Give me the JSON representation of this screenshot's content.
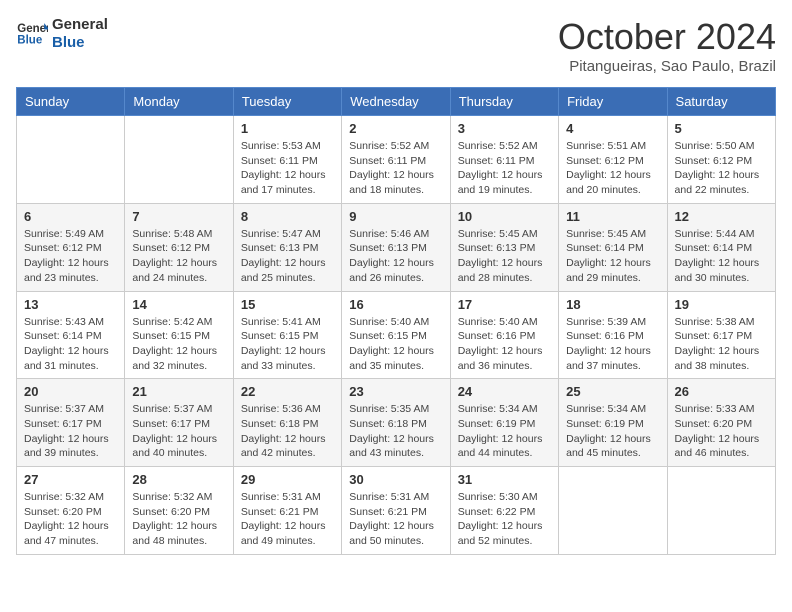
{
  "header": {
    "logo_line1": "General",
    "logo_line2": "Blue",
    "month_title": "October 2024",
    "location": "Pitangueiras, Sao Paulo, Brazil"
  },
  "days_of_week": [
    "Sunday",
    "Monday",
    "Tuesday",
    "Wednesday",
    "Thursday",
    "Friday",
    "Saturday"
  ],
  "weeks": [
    [
      {
        "day": "",
        "info": ""
      },
      {
        "day": "",
        "info": ""
      },
      {
        "day": "1",
        "info": "Sunrise: 5:53 AM\nSunset: 6:11 PM\nDaylight: 12 hours and 17 minutes."
      },
      {
        "day": "2",
        "info": "Sunrise: 5:52 AM\nSunset: 6:11 PM\nDaylight: 12 hours and 18 minutes."
      },
      {
        "day": "3",
        "info": "Sunrise: 5:52 AM\nSunset: 6:11 PM\nDaylight: 12 hours and 19 minutes."
      },
      {
        "day": "4",
        "info": "Sunrise: 5:51 AM\nSunset: 6:12 PM\nDaylight: 12 hours and 20 minutes."
      },
      {
        "day": "5",
        "info": "Sunrise: 5:50 AM\nSunset: 6:12 PM\nDaylight: 12 hours and 22 minutes."
      }
    ],
    [
      {
        "day": "6",
        "info": "Sunrise: 5:49 AM\nSunset: 6:12 PM\nDaylight: 12 hours and 23 minutes."
      },
      {
        "day": "7",
        "info": "Sunrise: 5:48 AM\nSunset: 6:12 PM\nDaylight: 12 hours and 24 minutes."
      },
      {
        "day": "8",
        "info": "Sunrise: 5:47 AM\nSunset: 6:13 PM\nDaylight: 12 hours and 25 minutes."
      },
      {
        "day": "9",
        "info": "Sunrise: 5:46 AM\nSunset: 6:13 PM\nDaylight: 12 hours and 26 minutes."
      },
      {
        "day": "10",
        "info": "Sunrise: 5:45 AM\nSunset: 6:13 PM\nDaylight: 12 hours and 28 minutes."
      },
      {
        "day": "11",
        "info": "Sunrise: 5:45 AM\nSunset: 6:14 PM\nDaylight: 12 hours and 29 minutes."
      },
      {
        "day": "12",
        "info": "Sunrise: 5:44 AM\nSunset: 6:14 PM\nDaylight: 12 hours and 30 minutes."
      }
    ],
    [
      {
        "day": "13",
        "info": "Sunrise: 5:43 AM\nSunset: 6:14 PM\nDaylight: 12 hours and 31 minutes."
      },
      {
        "day": "14",
        "info": "Sunrise: 5:42 AM\nSunset: 6:15 PM\nDaylight: 12 hours and 32 minutes."
      },
      {
        "day": "15",
        "info": "Sunrise: 5:41 AM\nSunset: 6:15 PM\nDaylight: 12 hours and 33 minutes."
      },
      {
        "day": "16",
        "info": "Sunrise: 5:40 AM\nSunset: 6:15 PM\nDaylight: 12 hours and 35 minutes."
      },
      {
        "day": "17",
        "info": "Sunrise: 5:40 AM\nSunset: 6:16 PM\nDaylight: 12 hours and 36 minutes."
      },
      {
        "day": "18",
        "info": "Sunrise: 5:39 AM\nSunset: 6:16 PM\nDaylight: 12 hours and 37 minutes."
      },
      {
        "day": "19",
        "info": "Sunrise: 5:38 AM\nSunset: 6:17 PM\nDaylight: 12 hours and 38 minutes."
      }
    ],
    [
      {
        "day": "20",
        "info": "Sunrise: 5:37 AM\nSunset: 6:17 PM\nDaylight: 12 hours and 39 minutes."
      },
      {
        "day": "21",
        "info": "Sunrise: 5:37 AM\nSunset: 6:17 PM\nDaylight: 12 hours and 40 minutes."
      },
      {
        "day": "22",
        "info": "Sunrise: 5:36 AM\nSunset: 6:18 PM\nDaylight: 12 hours and 42 minutes."
      },
      {
        "day": "23",
        "info": "Sunrise: 5:35 AM\nSunset: 6:18 PM\nDaylight: 12 hours and 43 minutes."
      },
      {
        "day": "24",
        "info": "Sunrise: 5:34 AM\nSunset: 6:19 PM\nDaylight: 12 hours and 44 minutes."
      },
      {
        "day": "25",
        "info": "Sunrise: 5:34 AM\nSunset: 6:19 PM\nDaylight: 12 hours and 45 minutes."
      },
      {
        "day": "26",
        "info": "Sunrise: 5:33 AM\nSunset: 6:20 PM\nDaylight: 12 hours and 46 minutes."
      }
    ],
    [
      {
        "day": "27",
        "info": "Sunrise: 5:32 AM\nSunset: 6:20 PM\nDaylight: 12 hours and 47 minutes."
      },
      {
        "day": "28",
        "info": "Sunrise: 5:32 AM\nSunset: 6:20 PM\nDaylight: 12 hours and 48 minutes."
      },
      {
        "day": "29",
        "info": "Sunrise: 5:31 AM\nSunset: 6:21 PM\nDaylight: 12 hours and 49 minutes."
      },
      {
        "day": "30",
        "info": "Sunrise: 5:31 AM\nSunset: 6:21 PM\nDaylight: 12 hours and 50 minutes."
      },
      {
        "day": "31",
        "info": "Sunrise: 5:30 AM\nSunset: 6:22 PM\nDaylight: 12 hours and 52 minutes."
      },
      {
        "day": "",
        "info": ""
      },
      {
        "day": "",
        "info": ""
      }
    ]
  ]
}
